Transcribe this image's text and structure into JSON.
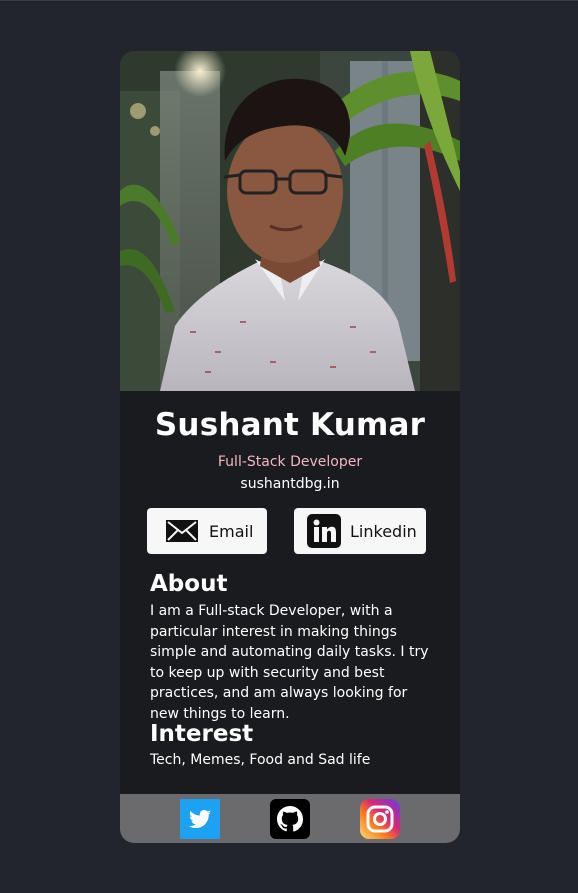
{
  "profile": {
    "name": "Sushant Kumar",
    "title": "Full-Stack Developer",
    "website": "sushantdbg.in"
  },
  "buttons": {
    "email_label": "Email",
    "linkedin_label": "Linkedin"
  },
  "about": {
    "heading": "About",
    "text": "I am a Full-stack Developer, with a particular interest in making things simple and automating daily tasks. I try to keep up with security and best practices, and am always looking for new things to learn."
  },
  "interest": {
    "heading": "Interest",
    "text": "Tech, Memes, Food and Sad life"
  },
  "footer": {
    "icons": [
      "twitter-icon",
      "github-icon",
      "instagram-icon"
    ]
  },
  "colors": {
    "page_background": "#23252c",
    "card_background": "#1a1b1f",
    "footer_background": "#6b6b6d",
    "title_accent": "#f4b6c2",
    "button_background": "#f7f7f7",
    "twitter_blue": "#1da1f2"
  }
}
